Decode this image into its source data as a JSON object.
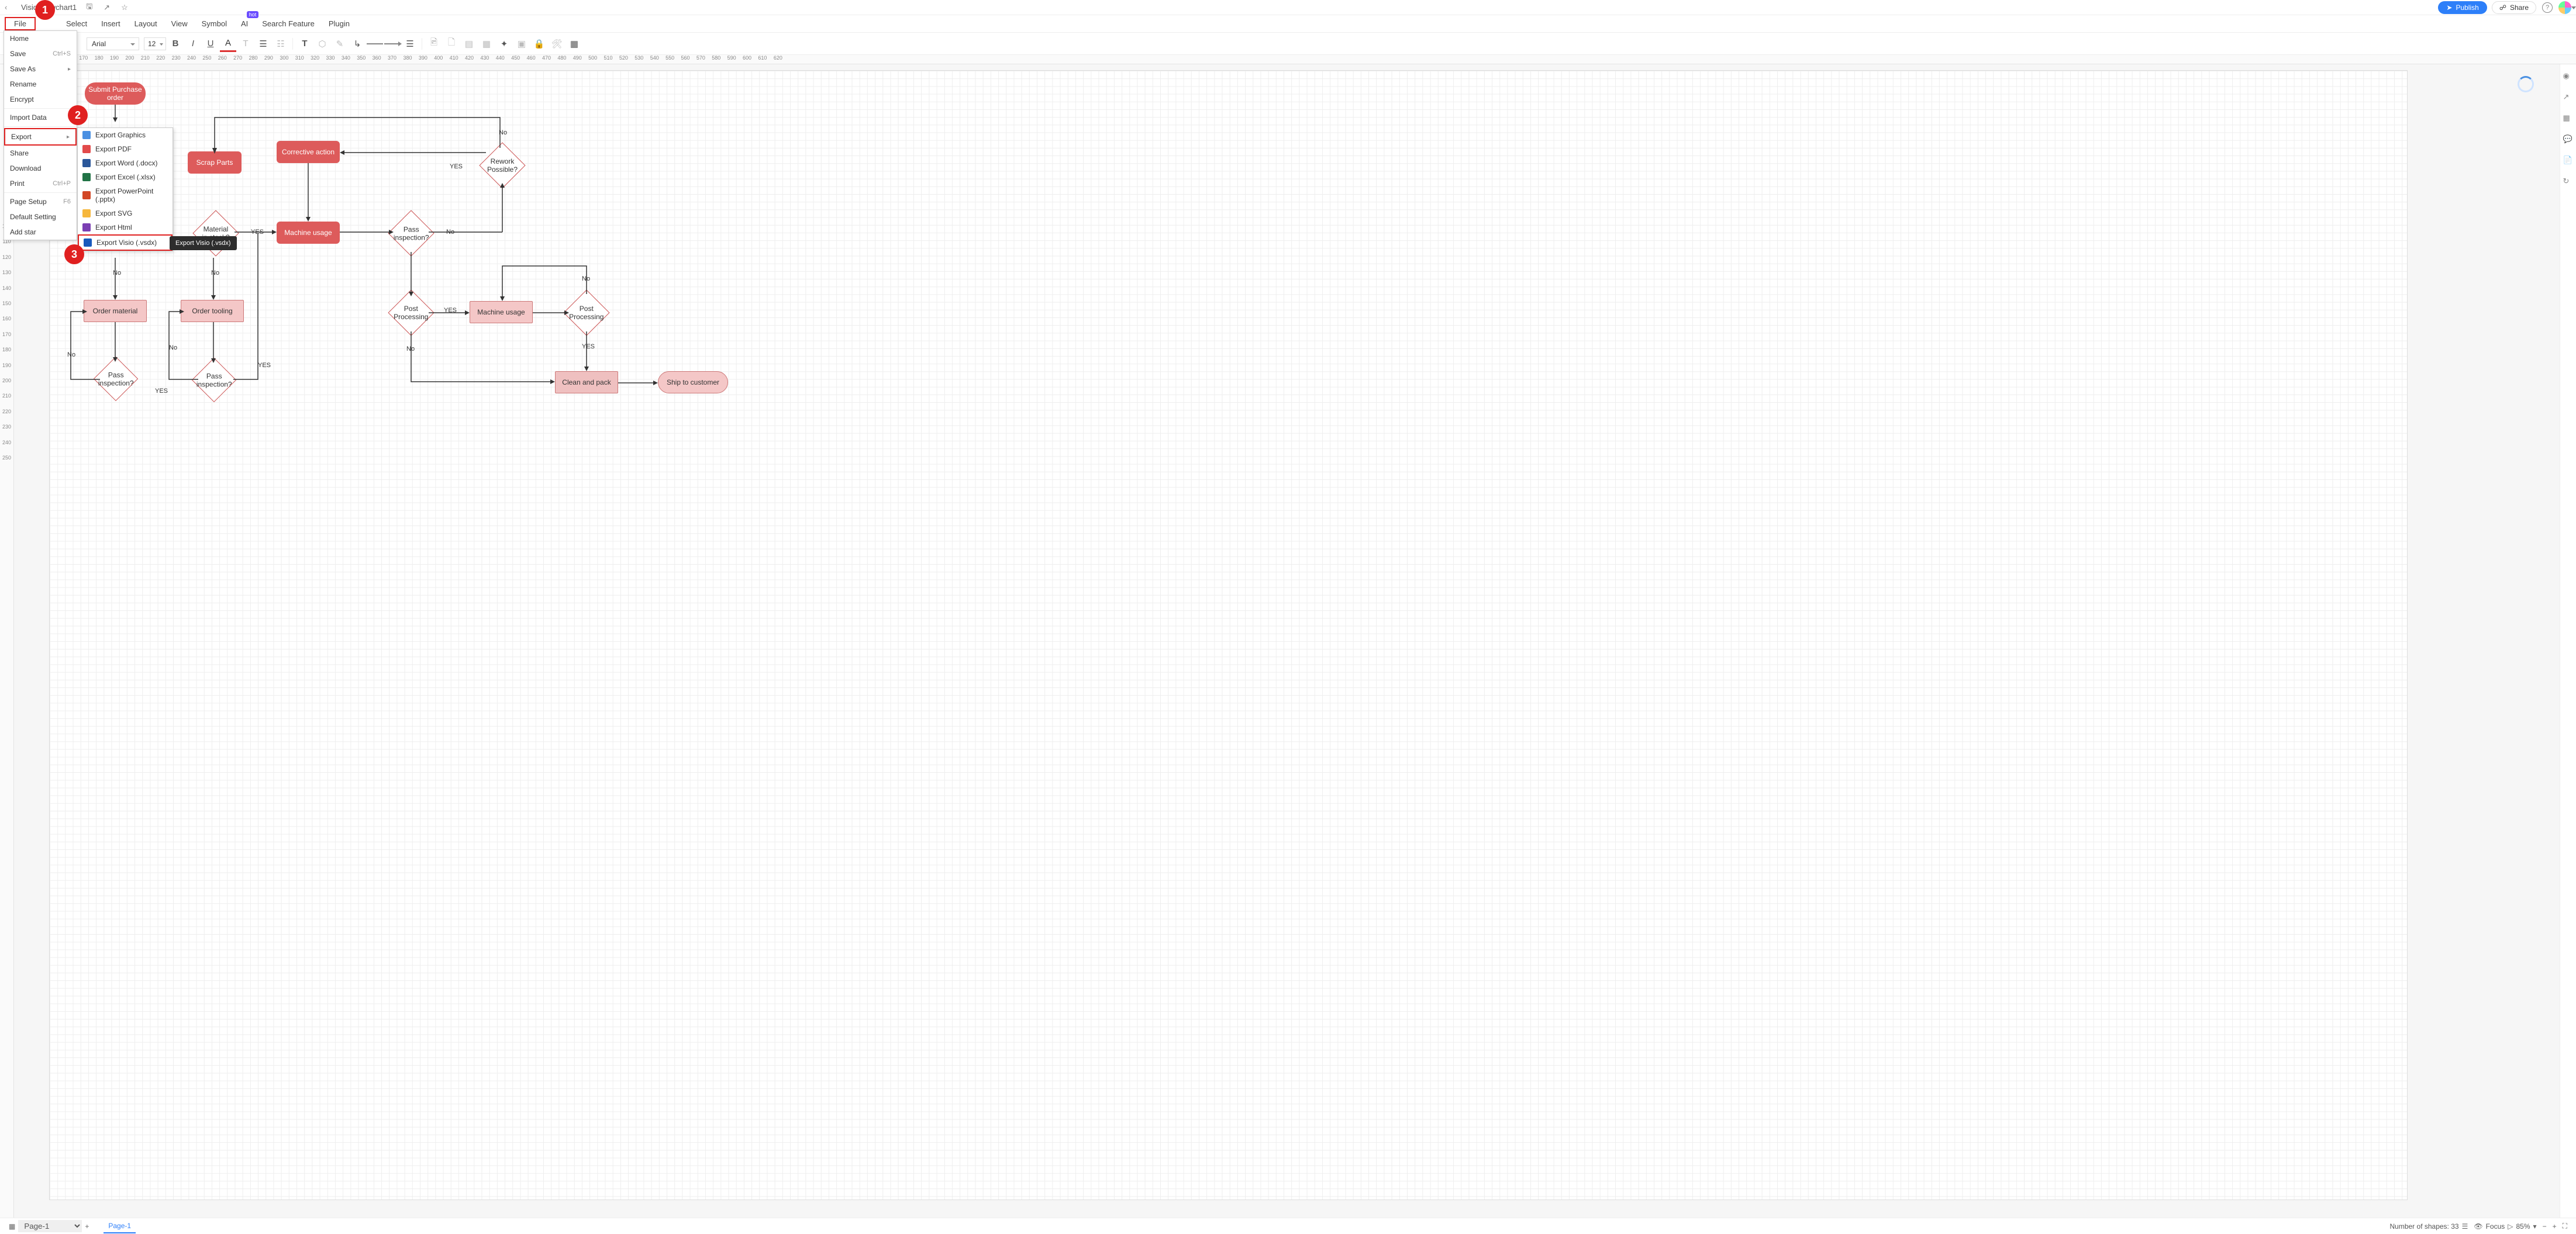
{
  "titlebar": {
    "title": "Visio Flowchart1"
  },
  "header": {
    "publish": "Publish",
    "share": "Share"
  },
  "menubar": [
    "File",
    "Select",
    "Insert",
    "Layout",
    "View",
    "Symbol",
    "AI",
    "Search Feature",
    "Plugin"
  ],
  "ai_hot": "hot",
  "toolbar": {
    "font": "Arial",
    "size": "12"
  },
  "ruler_h_start": 130,
  "ruler_h_step": 10,
  "ruler_h_count": 50,
  "ruler_v_start": 0,
  "ruler_v_step": 10,
  "ruler_v_count": 26,
  "file_menu": [
    {
      "label": "Home"
    },
    {
      "label": "Save",
      "shortcut": "Ctrl+S"
    },
    {
      "label": "Save As",
      "chev": true
    },
    {
      "label": "Rename"
    },
    {
      "label": "Encrypt"
    },
    {
      "sep": true
    },
    {
      "label": "Import Data"
    },
    {
      "sep": true
    },
    {
      "label": "Export",
      "chev": true,
      "hl": true
    },
    {
      "label": "Share"
    },
    {
      "label": "Download"
    },
    {
      "label": "Print",
      "shortcut": "Ctrl+P"
    },
    {
      "sep": true
    },
    {
      "label": "Page Setup",
      "shortcut": "F6"
    },
    {
      "label": "Default Setting"
    },
    {
      "label": "Add star"
    }
  ],
  "export_menu": [
    {
      "label": "Export Graphics",
      "c": "em-blue"
    },
    {
      "label": "Export PDF",
      "c": "em-red"
    },
    {
      "label": "Export Word (.docx)",
      "c": "em-darkblue"
    },
    {
      "label": "Export Excel (.xlsx)",
      "c": "em-green"
    },
    {
      "label": "Export PowerPoint (.pptx)",
      "c": "em-orange"
    },
    {
      "label": "Export SVG",
      "c": "em-yellow"
    },
    {
      "label": "Export Html",
      "c": "em-purple"
    },
    {
      "label": "Export Visio (.vsdx)",
      "c": "em-lblue",
      "sel": true
    }
  ],
  "tooltip": "Export Visio (.vsdx)",
  "anno": {
    "1": "1",
    "2": "2",
    "3": "3"
  },
  "shapes": {
    "submit": "Submit Purchase order",
    "scrap": "Scrap Parts",
    "corrective": "Corrective action",
    "rework": "Rework Possible?",
    "material": "Material in stock?",
    "machine1": "Machine usage",
    "passinsp1": "Pass inspection?",
    "ordermat": "Order material",
    "ordertool": "Order tooling",
    "passinsp2": "Pass inspection?",
    "passinsp3": "Pass inspection?",
    "postproc1": "Post Processing",
    "machine2": "Machine usage",
    "postproc2": "Post Processing",
    "clean": "Clean and pack",
    "ship": "Ship to customer"
  },
  "labels": {
    "yes": "YES",
    "no": "No",
    "no_lc": "No",
    "yes_lc": "Yes"
  },
  "footer": {
    "page_sel": "Page-1",
    "page_tab": "Page-1",
    "shapes": "Number of shapes: 33",
    "focus": "Focus",
    "zoom": "85%"
  }
}
